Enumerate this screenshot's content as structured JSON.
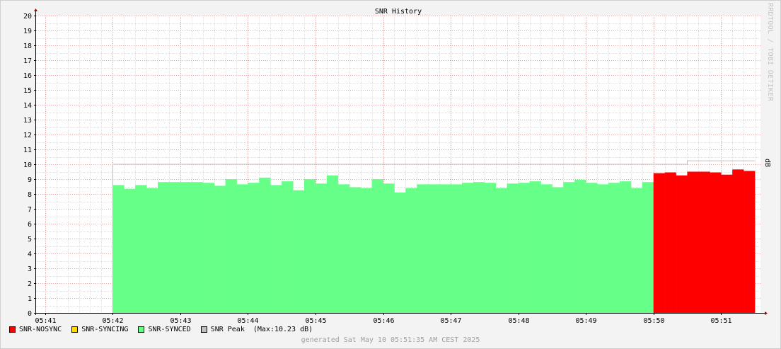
{
  "chart_data": {
    "type": "area",
    "title": "SNR History",
    "ylabel": "dB",
    "watermark": "RRDTOOL / TOBI OETIKER",
    "ylim": [
      0,
      20
    ],
    "y_ticks": [
      0,
      1,
      2,
      3,
      4,
      5,
      6,
      7,
      8,
      9,
      10,
      11,
      12,
      13,
      14,
      15,
      16,
      17,
      18,
      19,
      20
    ],
    "x_range": [
      "05:40:52",
      "05:51:35"
    ],
    "x_ticks": [
      "05:41",
      "05:42",
      "05:43",
      "05:44",
      "05:45",
      "05:46",
      "05:47",
      "05:48",
      "05:49",
      "05:50",
      "05:51"
    ],
    "grid": true,
    "legend_position": "bottom-left",
    "series": [
      {
        "name": "SNR-SYNCED",
        "color": "#66ff88",
        "start": "05:42:00",
        "step_seconds": 10,
        "values": [
          8.6,
          8.35,
          8.6,
          8.4,
          8.8,
          8.8,
          8.8,
          8.8,
          8.75,
          8.55,
          9.0,
          8.65,
          8.75,
          9.1,
          8.6,
          8.85,
          8.25,
          9.0,
          8.7,
          9.25,
          8.65,
          8.45,
          8.4,
          9.0,
          8.7,
          8.1,
          8.4,
          8.65,
          8.65,
          8.65,
          8.65,
          8.75,
          8.8,
          8.75,
          8.4,
          8.7,
          8.75,
          8.85,
          8.65,
          8.45,
          8.8,
          8.95,
          8.75,
          8.65,
          8.75,
          8.85,
          8.4,
          8.8
        ]
      },
      {
        "name": "SNR-NOSYNC",
        "color": "#ff0000",
        "start": "05:50:00",
        "step_seconds": 10,
        "values": [
          9.4,
          9.45,
          9.25,
          9.5,
          9.5,
          9.45,
          9.3,
          9.65,
          9.55
        ]
      },
      {
        "name": "SNR-SYNCING",
        "color": "#ffdd00",
        "values": []
      }
    ],
    "peak_line": {
      "name": "SNR Peak",
      "color": "#c0c0c0",
      "max": 10.23,
      "segments": [
        {
          "from": "05:42:00",
          "to": "05:50:30",
          "value": 10.0
        },
        {
          "from": "05:50:30",
          "to": "05:51:30",
          "value": 10.23
        }
      ]
    }
  },
  "legend": {
    "items": [
      {
        "label": "SNR-NOSYNC",
        "color": "#ff0000"
      },
      {
        "label": "SNR-SYNCING",
        "color": "#ffdd00"
      },
      {
        "label": "SNR-SYNCED",
        "color": "#66ff88"
      },
      {
        "label": "SNR Peak  (Max:10.23 dB)",
        "color": "#c0c0c0"
      }
    ]
  },
  "footer": "generated Sat May 10 05:51:35 AM CEST 2025"
}
